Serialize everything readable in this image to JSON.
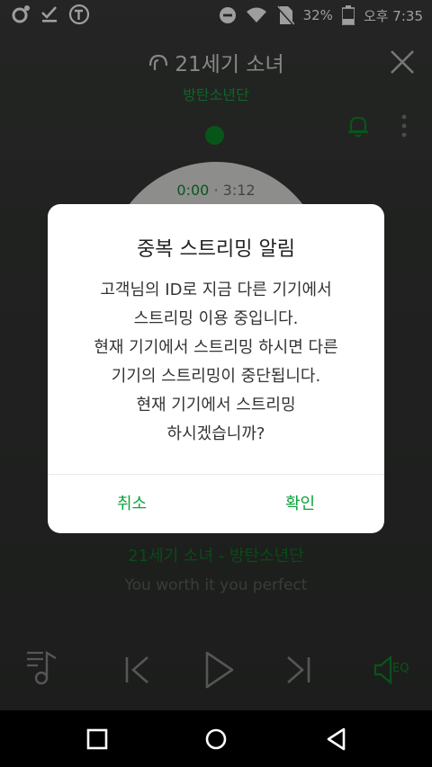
{
  "status_bar": {
    "battery": "32%",
    "time": "오후 7:35"
  },
  "player": {
    "song_title": "21세기 소녀",
    "artist": "방탄소년단",
    "time_current": "0:00",
    "time_separator": "·",
    "time_total": "3:12",
    "track_line": "21세기 소녀 - 방탄소년단",
    "lyric": "You worth it you perfect",
    "eq_label": "EQ"
  },
  "dialog": {
    "title": "중복 스트리밍 알림",
    "body": [
      "고객님의 ID로 지금 다른 기기에서",
      "스트리밍 이용 중입니다.",
      "현재 기기에서 스트리밍 하시면 다른",
      "기기의 스트리밍이 중단됩니다.",
      "현재 기기에서 스트리밍",
      "하시겠습니까?"
    ],
    "cancel_label": "취소",
    "confirm_label": "확인"
  },
  "colors": {
    "accent_green": "#0aa33a",
    "dim_overlay": "#000000"
  }
}
